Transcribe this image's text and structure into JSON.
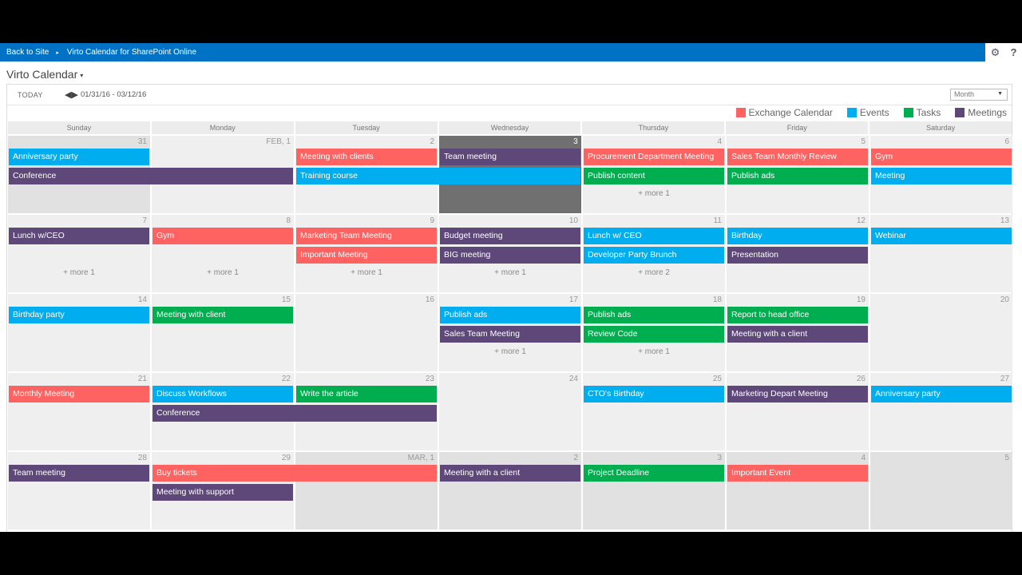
{
  "suitebar": {
    "back_label": "Back to Site",
    "separator": "▸",
    "app_label": "Virto Calendar for SharePoint Online",
    "settings_icon": "⚙",
    "help_icon": "?"
  },
  "title": {
    "label": "Virto Calendar",
    "caret": "▾"
  },
  "toolbar": {
    "today_label": "TODAY",
    "prev_icon": "◀",
    "next_icon": "▶",
    "date_range": "01/31/16 - 03/12/16",
    "view_selected": "Month",
    "view_dropdown_icon": "▼"
  },
  "colors": {
    "exchange": "#fe6361",
    "events": "#00adee",
    "tasks": "#00ad4f",
    "meetings": "#5e4879"
  },
  "legend": [
    {
      "label": "Exchange Calendar",
      "category": "exchange"
    },
    {
      "label": "Events",
      "category": "events"
    },
    {
      "label": "Tasks",
      "category": "tasks"
    },
    {
      "label": "Meetings",
      "category": "meetings"
    }
  ],
  "weekdays": [
    "Sunday",
    "Monday",
    "Tuesday",
    "Wednesday",
    "Thursday",
    "Friday",
    "Saturday"
  ],
  "weeks": [
    {
      "days": [
        {
          "label": "31",
          "type": "other"
        },
        {
          "label": "FEB, 1",
          "type": "normal"
        },
        {
          "label": "2",
          "type": "normal"
        },
        {
          "label": "3",
          "type": "today"
        },
        {
          "label": "4",
          "type": "normal",
          "more": "+ more 1"
        },
        {
          "label": "5",
          "type": "normal"
        },
        {
          "label": "6",
          "type": "normal"
        }
      ],
      "events": [
        {
          "title": "Anniversary party",
          "category": "events",
          "start": 0,
          "span": 1,
          "row": 0
        },
        {
          "title": "Conference",
          "category": "meetings",
          "start": 0,
          "span": 2,
          "row": 1
        },
        {
          "title": "Meeting with clients",
          "category": "exchange",
          "start": 2,
          "span": 1,
          "row": 0
        },
        {
          "title": "Team meeting",
          "category": "meetings",
          "start": 3,
          "span": 1,
          "row": 0
        },
        {
          "title": "Training course",
          "category": "events",
          "start": 2,
          "span": 2,
          "row": 1
        },
        {
          "title": "Procurement Department Meeting",
          "category": "exchange",
          "start": 4,
          "span": 1,
          "row": 0
        },
        {
          "title": "Publish content",
          "category": "tasks",
          "start": 4,
          "span": 1,
          "row": 1
        },
        {
          "title": "Sales Team Monthly Review",
          "category": "exchange",
          "start": 5,
          "span": 1,
          "row": 0
        },
        {
          "title": "Publish ads",
          "category": "tasks",
          "start": 5,
          "span": 1,
          "row": 1
        },
        {
          "title": "Gym",
          "category": "exchange",
          "start": 6,
          "span": 1,
          "row": 0
        },
        {
          "title": "Meeting",
          "category": "events",
          "start": 6,
          "span": 1,
          "row": 1
        }
      ]
    },
    {
      "days": [
        {
          "label": "7",
          "type": "normal",
          "more": "+ more 1"
        },
        {
          "label": "8",
          "type": "normal",
          "more": "+ more 1"
        },
        {
          "label": "9",
          "type": "normal",
          "more": "+ more 1"
        },
        {
          "label": "10",
          "type": "normal",
          "more": "+ more 1"
        },
        {
          "label": "11",
          "type": "normal",
          "more": "+ more 2"
        },
        {
          "label": "12",
          "type": "normal"
        },
        {
          "label": "13",
          "type": "normal"
        }
      ],
      "events": [
        {
          "title": "Lunch w/CEO",
          "category": "meetings",
          "start": 0,
          "span": 1,
          "row": 0
        },
        {
          "title": "Gym",
          "category": "exchange",
          "start": 1,
          "span": 1,
          "row": 0
        },
        {
          "title": "Marketing Team Meeting",
          "category": "exchange",
          "start": 2,
          "span": 1,
          "row": 0
        },
        {
          "title": "Important Meeting",
          "category": "exchange",
          "start": 2,
          "span": 1,
          "row": 1
        },
        {
          "title": "Budget meeting",
          "category": "meetings",
          "start": 3,
          "span": 1,
          "row": 0
        },
        {
          "title": "BIG meeting",
          "category": "meetings",
          "start": 3,
          "span": 1,
          "row": 1
        },
        {
          "title": "Lunch w/ CEO",
          "category": "events",
          "start": 4,
          "span": 1,
          "row": 0
        },
        {
          "title": "Developer Party Brunch",
          "category": "events",
          "start": 4,
          "span": 1,
          "row": 1
        },
        {
          "title": "Birthday",
          "category": "events",
          "start": 5,
          "span": 1,
          "row": 0
        },
        {
          "title": "Presentation",
          "category": "meetings",
          "start": 5,
          "span": 1,
          "row": 1
        },
        {
          "title": "Webinar",
          "category": "events",
          "start": 6,
          "span": 1,
          "row": 0
        }
      ]
    },
    {
      "days": [
        {
          "label": "14",
          "type": "normal"
        },
        {
          "label": "15",
          "type": "normal"
        },
        {
          "label": "16",
          "type": "normal"
        },
        {
          "label": "17",
          "type": "normal",
          "more": "+ more 1"
        },
        {
          "label": "18",
          "type": "normal",
          "more": "+ more 1"
        },
        {
          "label": "19",
          "type": "normal"
        },
        {
          "label": "20",
          "type": "normal"
        }
      ],
      "events": [
        {
          "title": "Birthday party",
          "category": "events",
          "start": 0,
          "span": 1,
          "row": 0
        },
        {
          "title": "Meeting with client",
          "category": "tasks",
          "start": 1,
          "span": 1,
          "row": 0
        },
        {
          "title": "Publish ads",
          "category": "events",
          "start": 3,
          "span": 1,
          "row": 0
        },
        {
          "title": "Sales Team Meeting",
          "category": "meetings",
          "start": 3,
          "span": 1,
          "row": 1
        },
        {
          "title": "Publish ads",
          "category": "tasks",
          "start": 4,
          "span": 1,
          "row": 0
        },
        {
          "title": "Review Code",
          "category": "tasks",
          "start": 4,
          "span": 1,
          "row": 1
        },
        {
          "title": "Report to head office",
          "category": "tasks",
          "start": 5,
          "span": 1,
          "row": 0
        },
        {
          "title": "Meeting with a client",
          "category": "meetings",
          "start": 5,
          "span": 1,
          "row": 1
        }
      ]
    },
    {
      "days": [
        {
          "label": "21",
          "type": "normal"
        },
        {
          "label": "22",
          "type": "normal"
        },
        {
          "label": "23",
          "type": "normal"
        },
        {
          "label": "24",
          "type": "normal"
        },
        {
          "label": "25",
          "type": "normal"
        },
        {
          "label": "26",
          "type": "normal"
        },
        {
          "label": "27",
          "type": "normal"
        }
      ],
      "events": [
        {
          "title": "Monthly Meeting",
          "category": "exchange",
          "start": 0,
          "span": 1,
          "row": 0
        },
        {
          "title": "Discuss Workflows",
          "category": "events",
          "start": 1,
          "span": 1,
          "row": 0
        },
        {
          "title": "Conference",
          "category": "meetings",
          "start": 1,
          "span": 2,
          "row": 1
        },
        {
          "title": "Write the article",
          "category": "tasks",
          "start": 2,
          "span": 1,
          "row": 0
        },
        {
          "title": "CTO's Birthday",
          "category": "events",
          "start": 4,
          "span": 1,
          "row": 0
        },
        {
          "title": "Marketing Depart Meeting",
          "category": "meetings",
          "start": 5,
          "span": 1,
          "row": 0
        },
        {
          "title": "Anniversary party",
          "category": "events",
          "start": 6,
          "span": 1,
          "row": 0
        }
      ]
    },
    {
      "days": [
        {
          "label": "28",
          "type": "normal"
        },
        {
          "label": "29",
          "type": "normal"
        },
        {
          "label": "MAR, 1",
          "type": "other"
        },
        {
          "label": "2",
          "type": "other"
        },
        {
          "label": "3",
          "type": "other"
        },
        {
          "label": "4",
          "type": "other"
        },
        {
          "label": "5",
          "type": "other"
        }
      ],
      "events": [
        {
          "title": "Team meeting",
          "category": "meetings",
          "start": 0,
          "span": 1,
          "row": 0
        },
        {
          "title": "Buy tickets",
          "category": "exchange",
          "start": 1,
          "span": 2,
          "row": 0
        },
        {
          "title": "Meeting with support",
          "category": "meetings",
          "start": 1,
          "span": 1,
          "row": 1
        },
        {
          "title": "Meeting with a client",
          "category": "meetings",
          "start": 3,
          "span": 1,
          "row": 0
        },
        {
          "title": "Project Deadline",
          "category": "tasks",
          "start": 4,
          "span": 1,
          "row": 0
        },
        {
          "title": "Important Event",
          "category": "exchange",
          "start": 5,
          "span": 1,
          "row": 0
        }
      ]
    }
  ]
}
